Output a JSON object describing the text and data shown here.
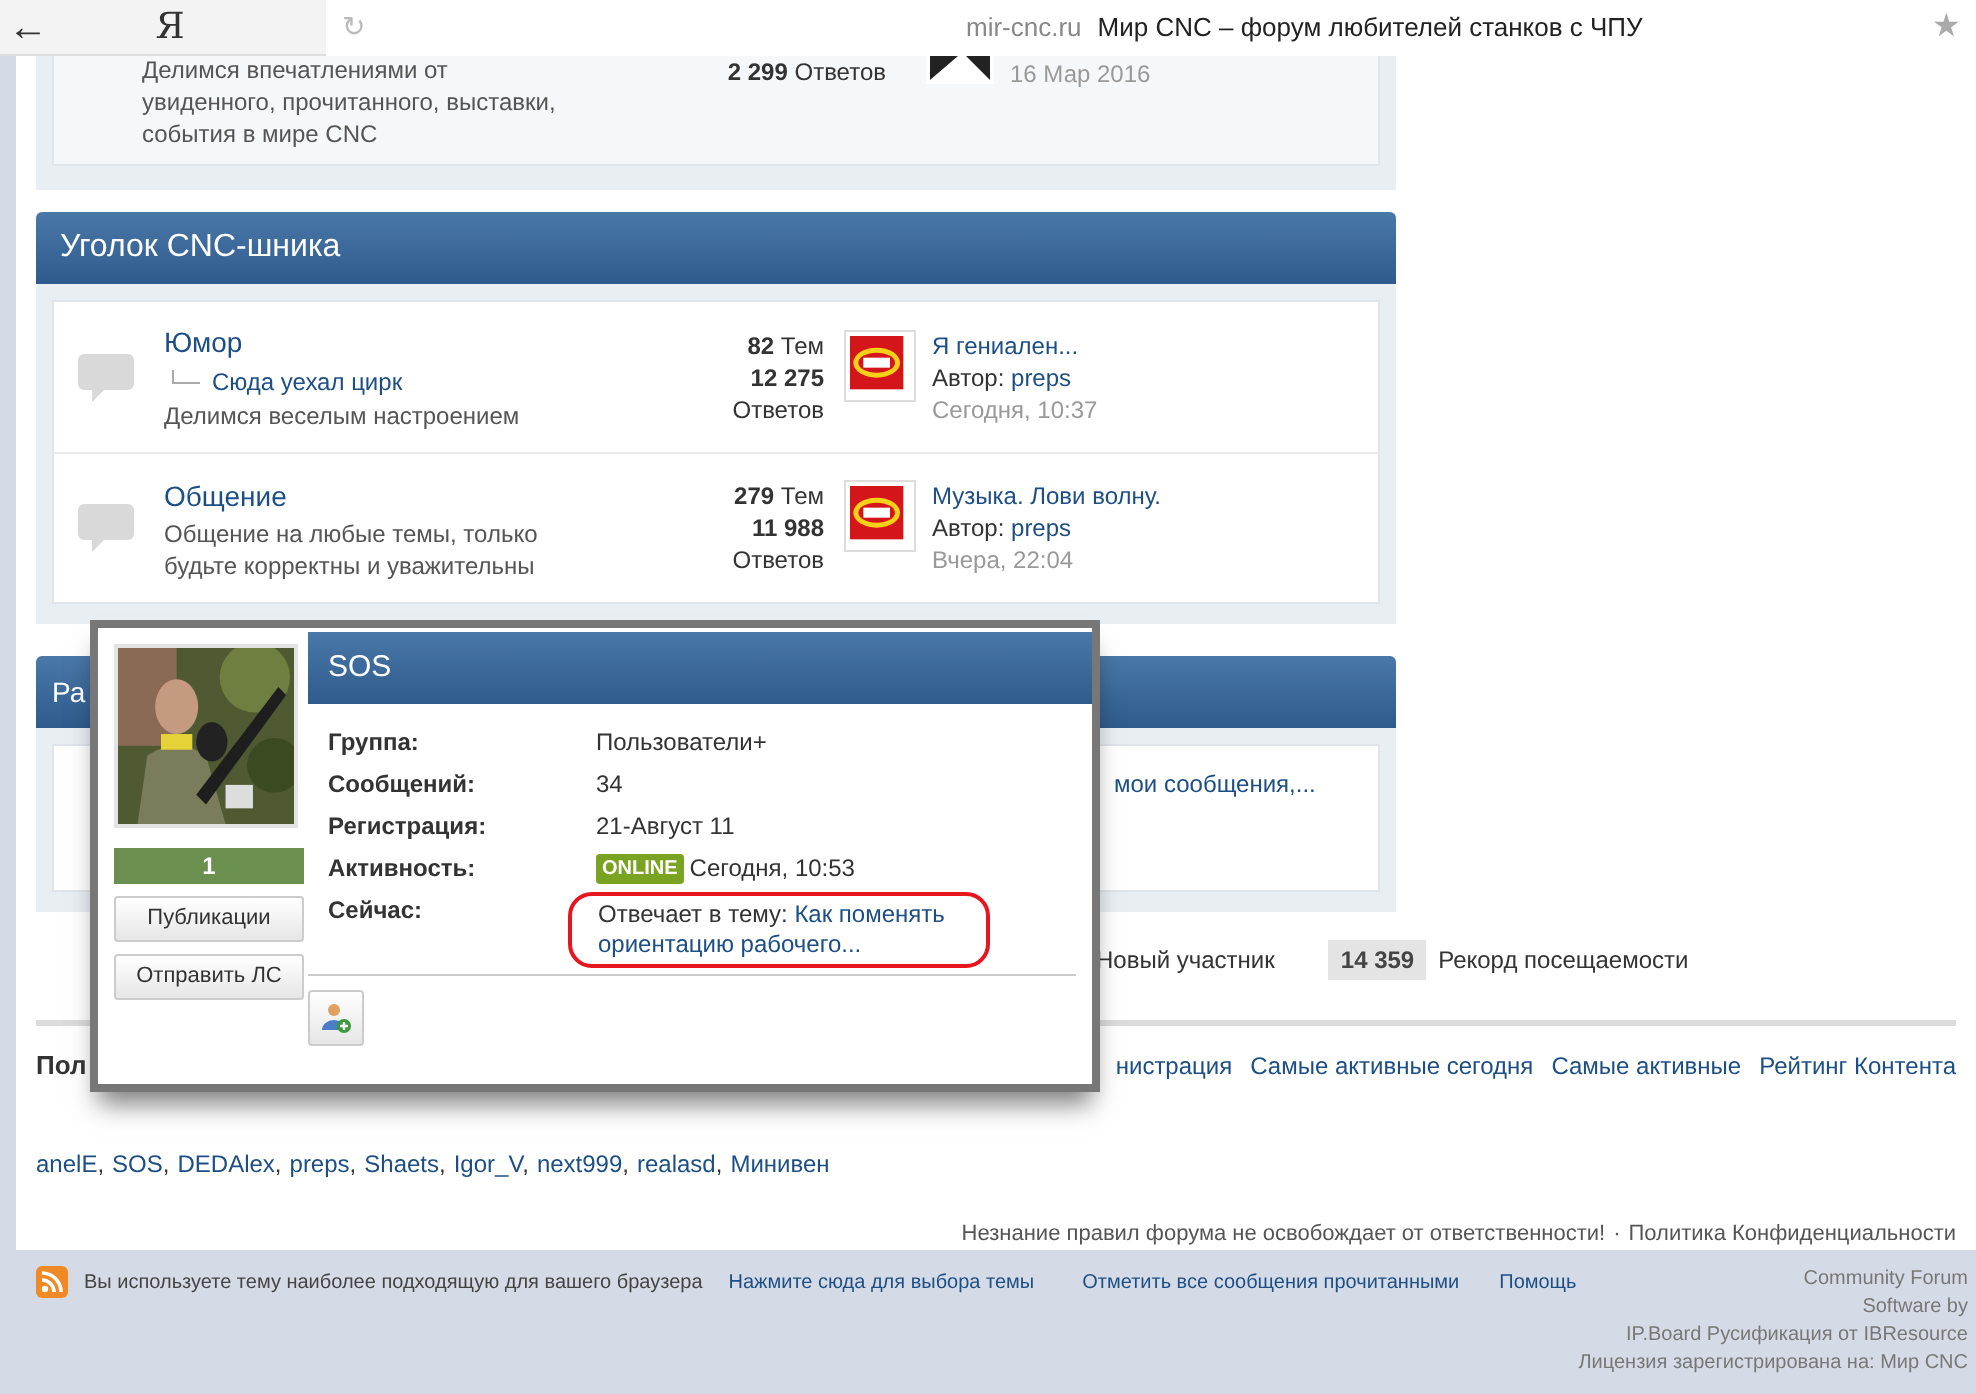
{
  "browser": {
    "back": "←",
    "logo": "Я",
    "reload": "↻",
    "domain": "mir-cnc.ru",
    "title": "Мир CNC – форум любителей станков с ЧПУ",
    "star": "★"
  },
  "top_forum": {
    "description": "Делимся впечатлениями от увиденного, прочитанного, выставки, события в мире CNC",
    "replies_count": "2 299",
    "replies_label": "Ответов",
    "date": "16 Мар 2016"
  },
  "category": {
    "title": "Уголок CNC-шника",
    "forums": [
      {
        "name": "Юмор",
        "subforum": "Сюда уехал цирк",
        "description": "Делимся веселым настроением",
        "topics_count": "82",
        "topics_label": "Тем",
        "replies_count": "12 275",
        "replies_label": "Ответов",
        "last_post": "Я гениален...",
        "author_label": "Автор:",
        "author": "preps",
        "time": "Сегодня, 10:37"
      },
      {
        "name": "Общение",
        "description": "Общение на любые темы, только будьте корректны и уважительны",
        "topics_count": "279",
        "topics_label": "Тем",
        "replies_count": "11 988",
        "replies_label": "Ответов",
        "last_post": "Музыка. Лови волну.",
        "author_label": "Автор:",
        "author": "preps",
        "time": "Вчера, 22:04"
      }
    ]
  },
  "category_2": {
    "title_visible": "Ра",
    "last_post_visible": "мои сообщения,..."
  },
  "stats": {
    "new_member_label": "Новый участник",
    "record_value": "14 359",
    "record_label": "Рекорд посещаемости"
  },
  "online": {
    "heading_visible": "Пол",
    "links": [
      "нистрация",
      "Самые активные сегодня",
      "Самые активные",
      "Рейтинг Контента"
    ],
    "name_separator": ",",
    "names": [
      "anelE",
      "SOS",
      "DEDAlex",
      "preps",
      "Shaets",
      "Igor_V",
      "next999",
      "realasd",
      "Минивен"
    ]
  },
  "disclaimer": {
    "text": "Незнание правил форума не освобождает от ответственности!",
    "separator": "·",
    "link": "Политика Конфиденциальности"
  },
  "footer": {
    "theme_text": "Вы используете тему наиболее подходящую для вашего браузера",
    "theme_link": "Нажмите сюда для выбора темы",
    "mark_read": "Отметить все сообщения прочитанными",
    "help": "Помощь",
    "credits": [
      "Community Forum",
      "Software by",
      "IP.Board Русификация от IBResource",
      "Лицензия зарегистрирована на: Мир CNC"
    ]
  },
  "popup": {
    "name": "SOS",
    "reputation": "1",
    "buttons": [
      "Публикации",
      "Отправить ЛС"
    ],
    "fields": [
      {
        "kind": "text",
        "label": "Группа:",
        "value": "Пользователи+"
      },
      {
        "kind": "text",
        "label": "Сообщений:",
        "value": "34"
      },
      {
        "kind": "text",
        "label": "Регистрация:",
        "value": "21-Август 11"
      },
      {
        "kind": "status",
        "label": "Активность:",
        "badge": "ONLINE",
        "online": true,
        "value": "Сегодня, 10:53"
      },
      {
        "kind": "link",
        "label": "Сейчас:",
        "prefix": "Отвечает в тему:",
        "link": "Как поменять ориентацию рабочего...",
        "highlighted": true
      }
    ]
  }
}
